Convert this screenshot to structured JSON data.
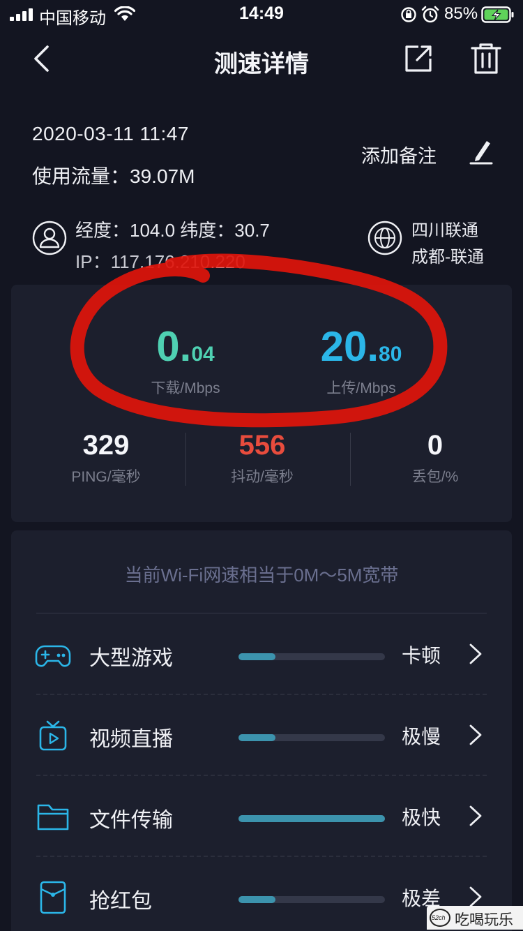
{
  "status_bar": {
    "carrier": "中国移动",
    "time": "14:49",
    "battery_percent": "85%"
  },
  "nav": {
    "title": "测速详情"
  },
  "info": {
    "datetime": "2020-03-11   11:47",
    "traffic_label": "使用流量：",
    "traffic_value": "39.07M",
    "add_note": "添加备注",
    "coordinates": "经度：104.0  纬度：30.7",
    "ip": "IP：117.176.210.220",
    "isp_line1": "四川联通",
    "isp_line2": "成都-联通"
  },
  "speed": {
    "download_int": "0.",
    "download_dec": "04",
    "download_label": "下载/Mbps",
    "upload_int": "20.",
    "upload_dec": "80",
    "upload_label": "上传/Mbps",
    "ping_value": "329",
    "ping_label": "PING/毫秒",
    "jitter_value": "556",
    "jitter_label": "抖动/毫秒",
    "loss_value": "0",
    "loss_label": "丢包/%"
  },
  "quality": {
    "summary": "当前Wi-Fi网速相当于0M～5M宽带",
    "rows": [
      {
        "name": "大型游戏",
        "status": "卡顿",
        "level": 0.25
      },
      {
        "name": "视频直播",
        "status": "极慢",
        "level": 0.25
      },
      {
        "name": "文件传输",
        "status": "极快",
        "level": 1.0
      },
      {
        "name": "抢红包",
        "status": "极差",
        "level": 0.25
      }
    ]
  },
  "watermark": {
    "logo_text": "52ch",
    "text": "吃喝玩乐网"
  },
  "colors": {
    "background": "#131521",
    "card": "#1c1f2d",
    "download": "#4fd0b2",
    "upload": "#2bb6e8",
    "bar_fill": "#3c93ad",
    "battery": "#5fd35a",
    "annotation": "#e0150b"
  }
}
